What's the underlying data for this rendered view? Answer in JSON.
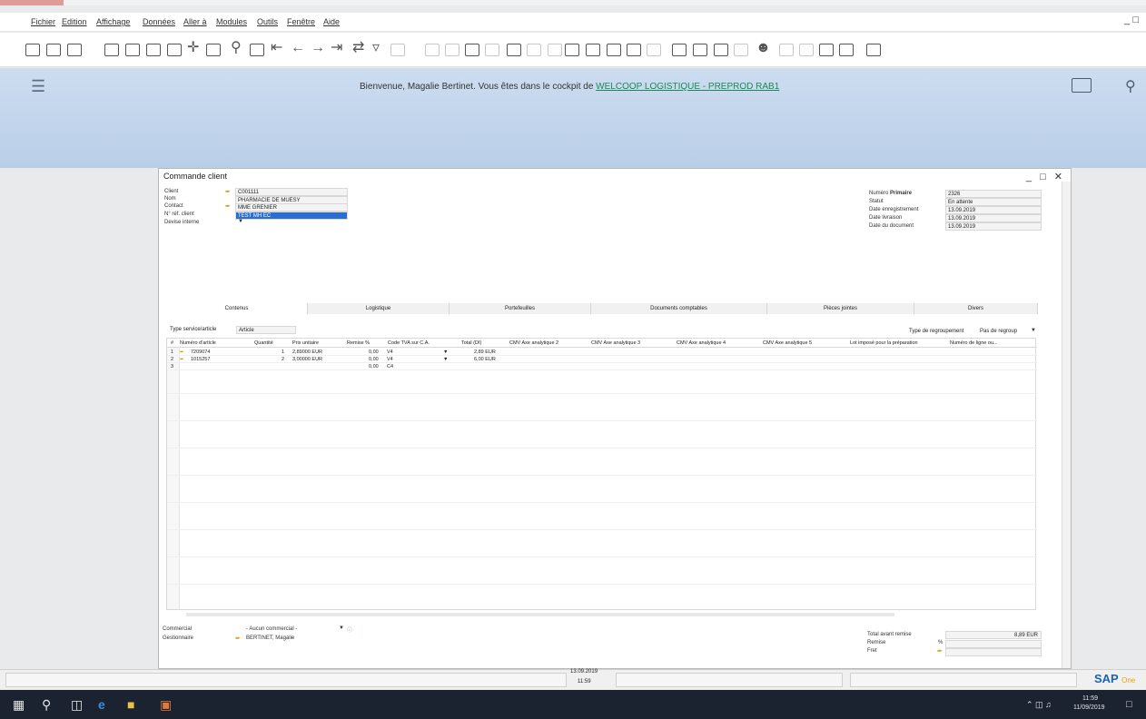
{
  "menu": [
    "Fichier",
    "Edition",
    "Affichage",
    "Données",
    "Aller à",
    "Modules",
    "Outils",
    "Fenêtre",
    "Aide"
  ],
  "cockpit": {
    "welcome_text": "Bienvenue, Magalie Bertinet. Vous êtes dans le cockpit de ",
    "company_link": "WELCOOP LOGISTIQUE - PREPROD RAB1"
  },
  "document": {
    "title": "Commande client",
    "left_fields": {
      "client_label": "Client",
      "client_value": "C001111",
      "name_label": "Nom",
      "name_value": "PHARMACIE DE MUESY",
      "contact_label": "Contact",
      "contact_value": "MME GRENIER",
      "ref_label": "N° réf. client",
      "ref_value": "TEST MH EC",
      "currency_label": "Devise interne"
    },
    "right_fields": {
      "primary_label": "Numéro",
      "primary_emphasis": "Primaire",
      "primary_value": "2326",
      "status_label": "Statut",
      "status_value": "En attente",
      "reg_date_label": "Date enregistrement",
      "reg_date_value": "13.09.2019",
      "delivery_label": "Date livraison",
      "delivery_value": "13.09.2019",
      "doc_date_label": "Date du document",
      "doc_date_value": "13.09.2019"
    },
    "tabs": [
      "Contenus",
      "Logistique",
      "Portefeuilles",
      "Documents comptables",
      "Pièces jointes",
      "Divers"
    ],
    "service_type_label": "Type service/article",
    "service_type_value": "Article",
    "grouping_label": "Type de regroupement",
    "grouping_value": "Pas de regroup",
    "columns": [
      "#",
      "Numéro d'article",
      "Quantité",
      "Prix unitaire",
      "Remise %",
      "Code TVA sur C.A.",
      "Total (DI)",
      "CMV Axe analytique 2",
      "CMV Axe analytique 3",
      "CMV Axe analytique 4",
      "CMV Axe analytique 5",
      "Lot imposé pour la préparation",
      "Numéro de ligne ou..."
    ],
    "rows": [
      {
        "num": "1",
        "article": "7209074",
        "qty": "1",
        "price": "2,89000 EUR",
        "discount": "0,00",
        "vat": "V4",
        "total": "2,89 EUR"
      },
      {
        "num": "2",
        "article": "1015257",
        "qty": "2",
        "price": "3,00000 EUR",
        "discount": "0,00",
        "vat": "V4",
        "total": "6,00 EUR"
      },
      {
        "num": "3",
        "article": "",
        "qty": "",
        "price": "",
        "discount": "0,00",
        "vat": "C4",
        "total": ""
      }
    ],
    "footer": {
      "sales_label": "Commercial",
      "sales_value": "- Aucun commercial -",
      "manager_label": "Gestionnaire",
      "manager_value": "BERTINET, Magalie",
      "total_before_label": "Total avant remise",
      "total_before_value": "8,89 EUR",
      "discount_label": "Remise",
      "discount_unit": "%",
      "freight_label": "Fret"
    }
  },
  "statusbar": {
    "date": "13.09.2019",
    "time": "11:59"
  },
  "taskbar": {
    "clock_time": "11:59",
    "clock_date": "11/09/2019"
  },
  "brand": {
    "sap": "SAP",
    "one": "One"
  },
  "colors": {
    "accent": "#2a6fcf",
    "link": "#1a8a55",
    "cockpit": "#c6d8ee",
    "arrow": "#e0a020"
  }
}
